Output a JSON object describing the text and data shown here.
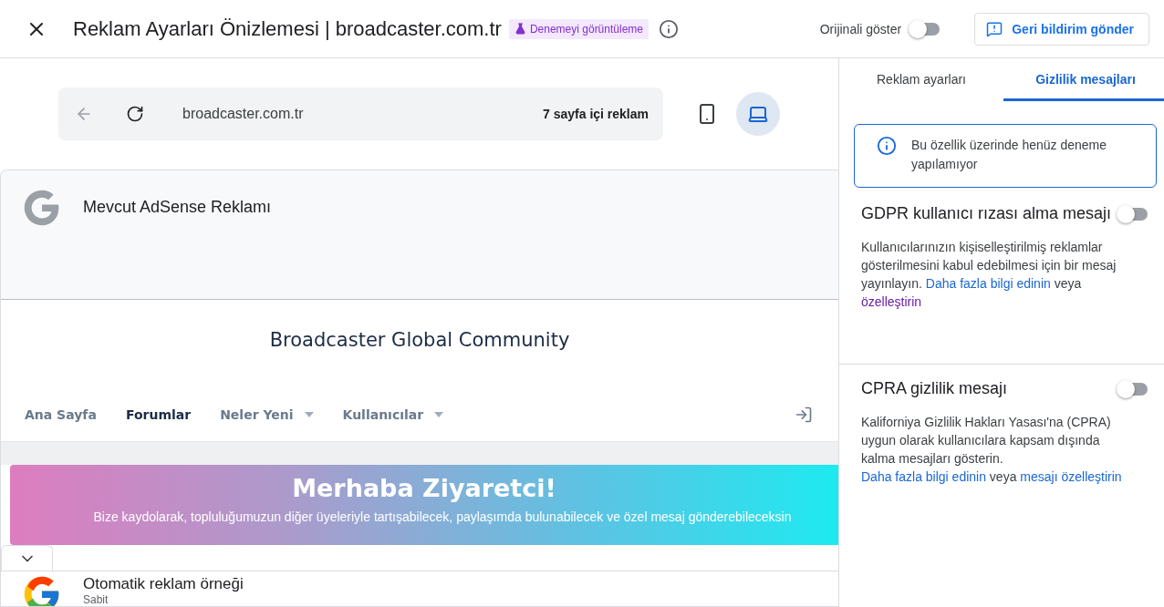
{
  "header": {
    "title": "Reklam Ayarları Önizlemesi | broadcaster.com.tr",
    "badge": "Denemeyi görüntüleme",
    "toggle": {
      "label": "Orijinali göster",
      "on": false
    },
    "feedback_button": "Geri bildirim gönder"
  },
  "browser_bar": {
    "url": "broadcaster.com.tr",
    "ad_count": "7 sayfa içi reklam"
  },
  "devices": [
    {
      "kind": "mobile",
      "selected": false
    },
    {
      "kind": "desktop",
      "selected": true
    }
  ],
  "preview": {
    "top_ad": {
      "title": "Mevcut AdSense Reklamı"
    },
    "site": {
      "title": "Broadcaster Global Community",
      "nav": [
        {
          "label": "Ana Sayfa",
          "selected": false,
          "dropdown": false
        },
        {
          "label": "Forumlar",
          "selected": true,
          "dropdown": false
        },
        {
          "label": "Neler Yeni",
          "selected": false,
          "dropdown": true
        },
        {
          "label": "Kullanıcılar",
          "selected": false,
          "dropdown": true
        }
      ],
      "banner": {
        "title": "Merhaba Ziyaretci!",
        "text": "Bize kaydolarak, topluluğumuzun diğer üyeleriyle tartışabilecek, paylaşımda bulunabilecek ve özel mesaj gönderebileceksin"
      }
    },
    "bottom_ad": {
      "title": "Otomatik reklam örneği",
      "subtitle": "Sabit"
    }
  },
  "panel": {
    "tabs": [
      {
        "label": "Reklam ayarları",
        "selected": false
      },
      {
        "label": "Gizlilik mesajları",
        "selected": true
      }
    ],
    "notice": "Bu özellik üzerinde henüz deneme yapılamıyor",
    "sections": [
      {
        "title": "GDPR kullanıcı rızası alma mesajı",
        "on": false,
        "text": [
          {
            "kind": "text",
            "text": "Kullanıcılarınızın kişiselleştirilmiş reklamlar gösterilmesini kabul edebilmesi için bir mesaj yayınlayın. "
          },
          {
            "kind": "link",
            "text": "Daha fazla bilgi edinin",
            "visited": false
          },
          {
            "kind": "text",
            "text": " veya "
          },
          {
            "kind": "link",
            "text": "özelleştirin",
            "visited": true
          }
        ]
      },
      {
        "title": "CPRA gizlilik mesajı",
        "on": false,
        "text": [
          {
            "kind": "text",
            "text": "Kaliforniya Gizlilik Hakları Yasası'na (CPRA) uygun olarak kullanıcılara kapsam dışında kalma mesajları gösterin. "
          },
          {
            "kind": "link",
            "text": "Daha fazla bilgi edinin",
            "visited": false
          },
          {
            "kind": "text",
            "text": " veya "
          },
          {
            "kind": "link",
            "text": "mesajı özelleştirin",
            "visited": false
          }
        ]
      }
    ]
  }
}
